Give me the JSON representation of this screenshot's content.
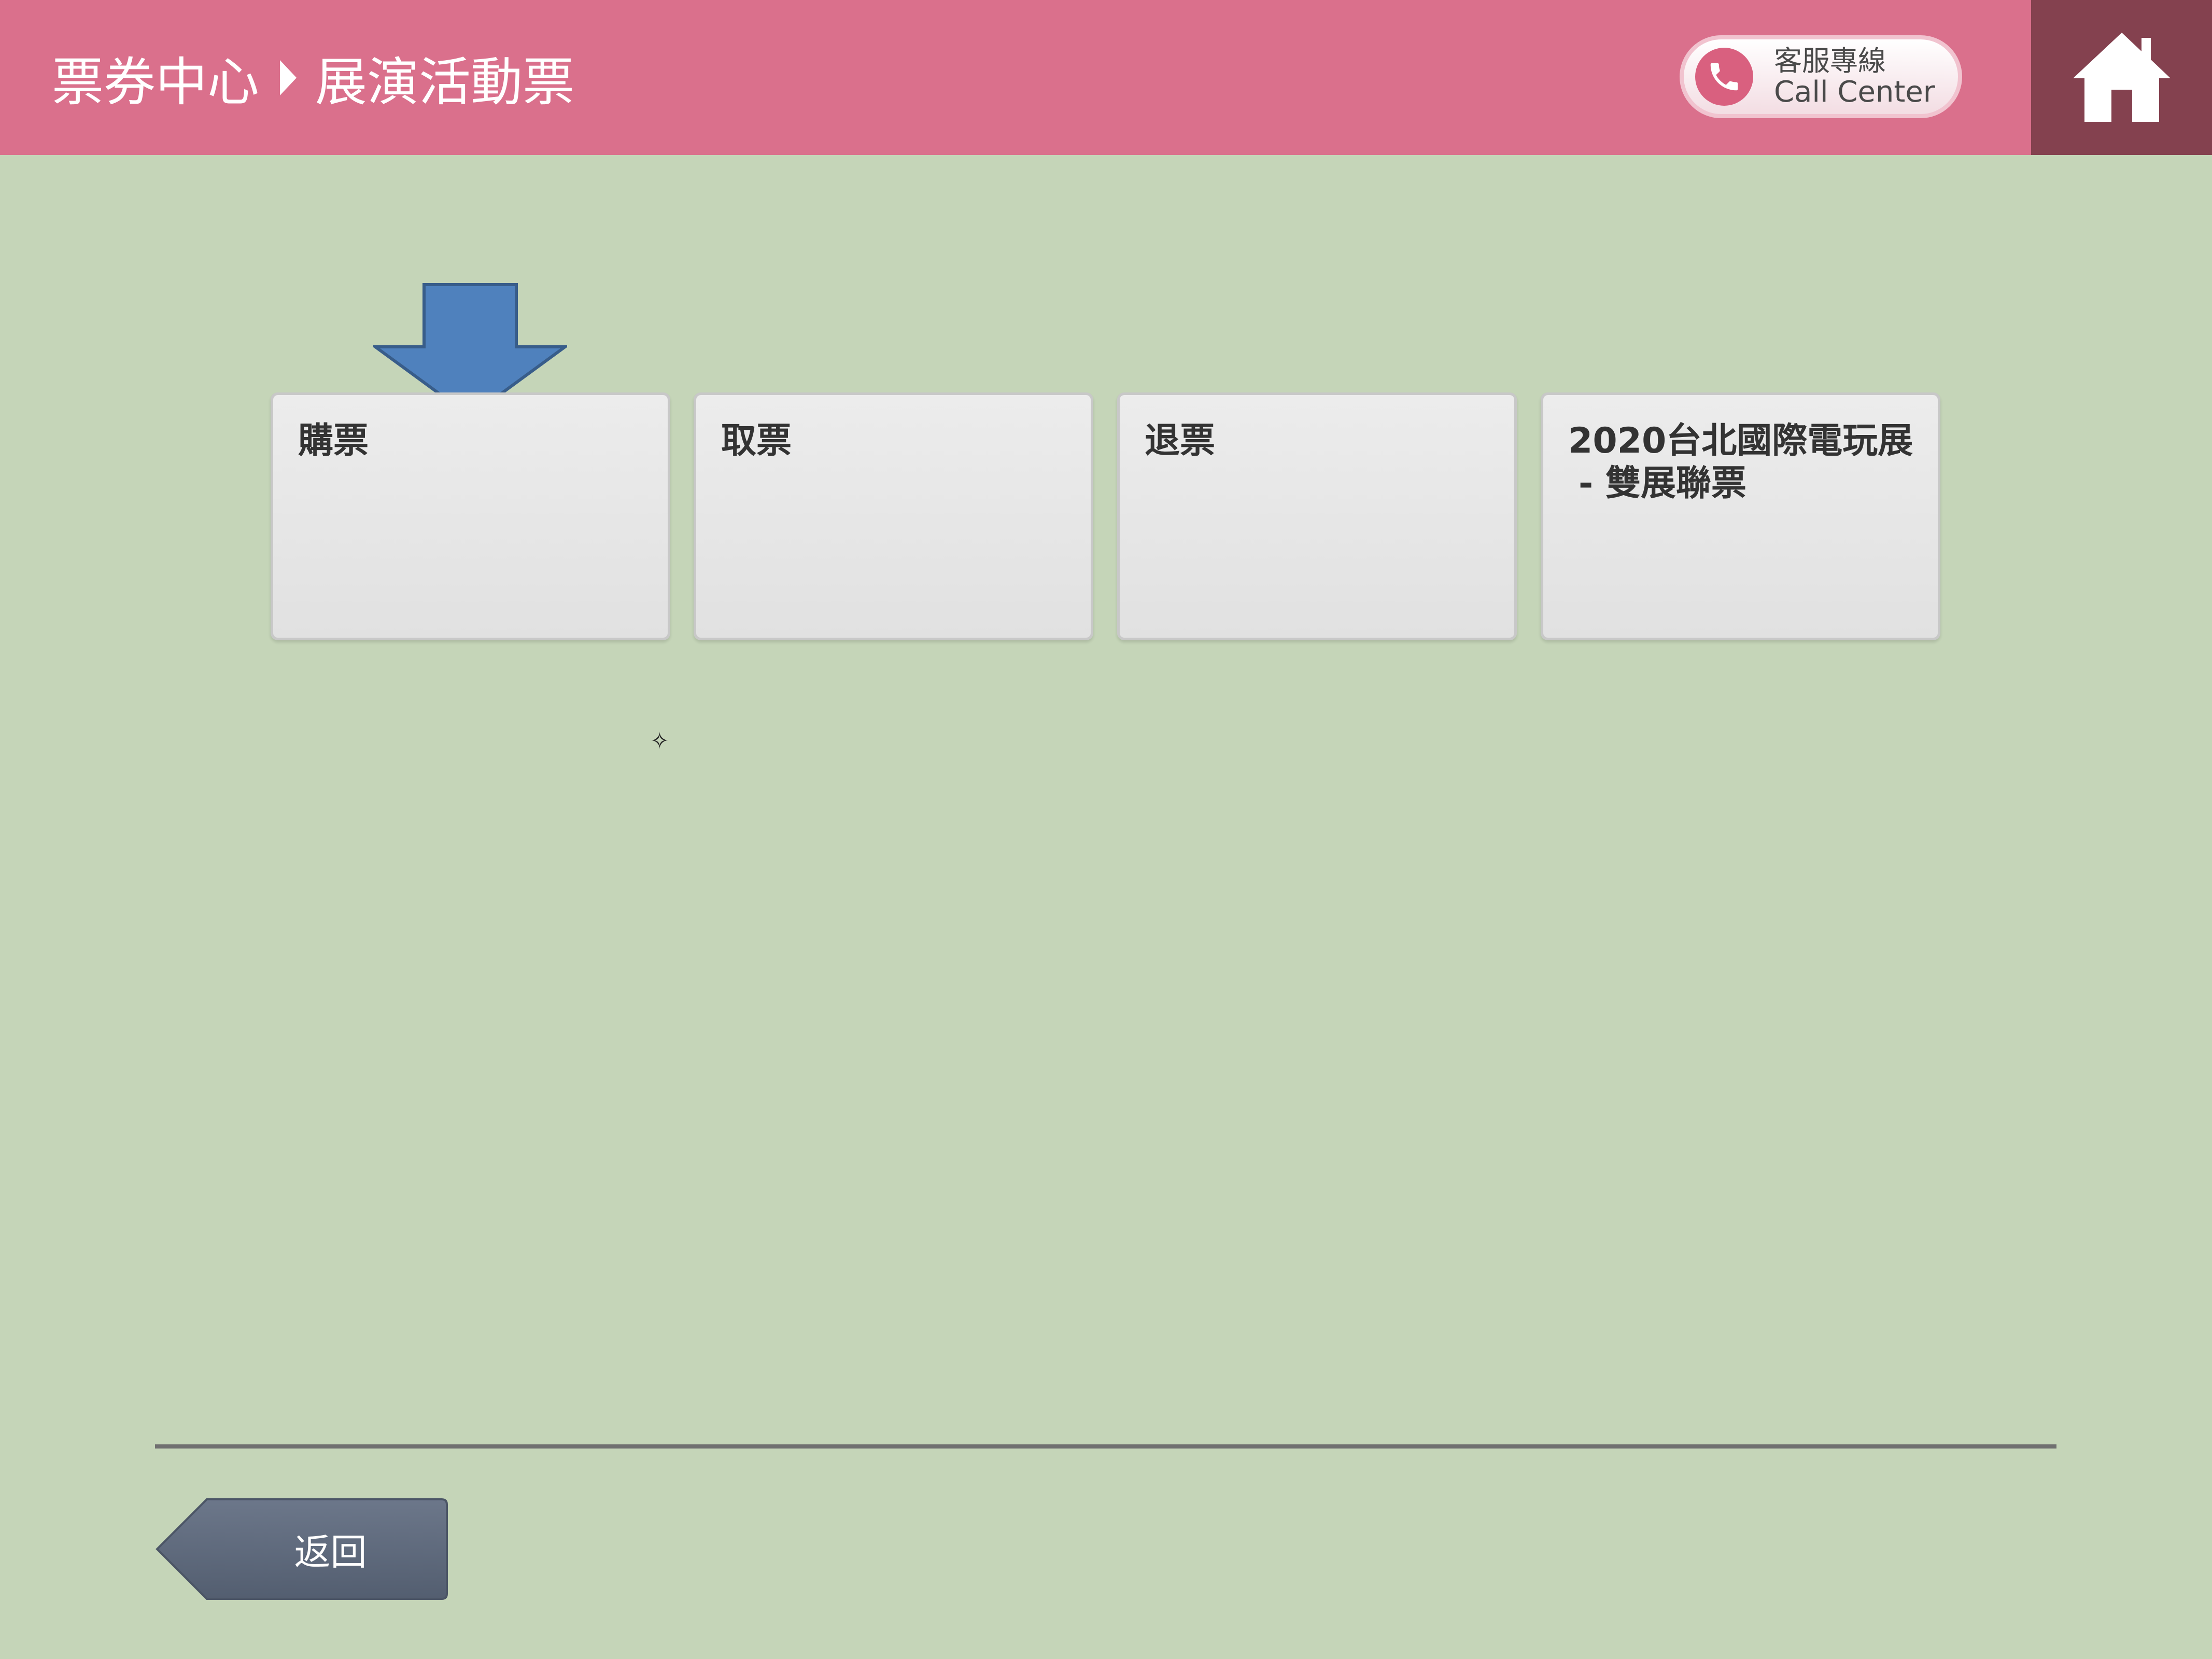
{
  "header": {
    "breadcrumb": {
      "root": "票券中心",
      "current": "展演活動票"
    },
    "call_center": {
      "line1": "客服專線",
      "line2": "Call Center"
    },
    "home_icon": "home-icon"
  },
  "cards": [
    {
      "label": "購票"
    },
    {
      "label": "取票"
    },
    {
      "label": "退票"
    },
    {
      "label": "2020台北國際電玩展",
      "sublabel": "- 雙展聯票"
    }
  ],
  "footer": {
    "back_label": "返回"
  },
  "colors": {
    "header": "#da708c",
    "home_area": "#84414f",
    "background": "#c5d5b8",
    "arrow": "#4f81bd",
    "back_button": "#5a6577"
  }
}
